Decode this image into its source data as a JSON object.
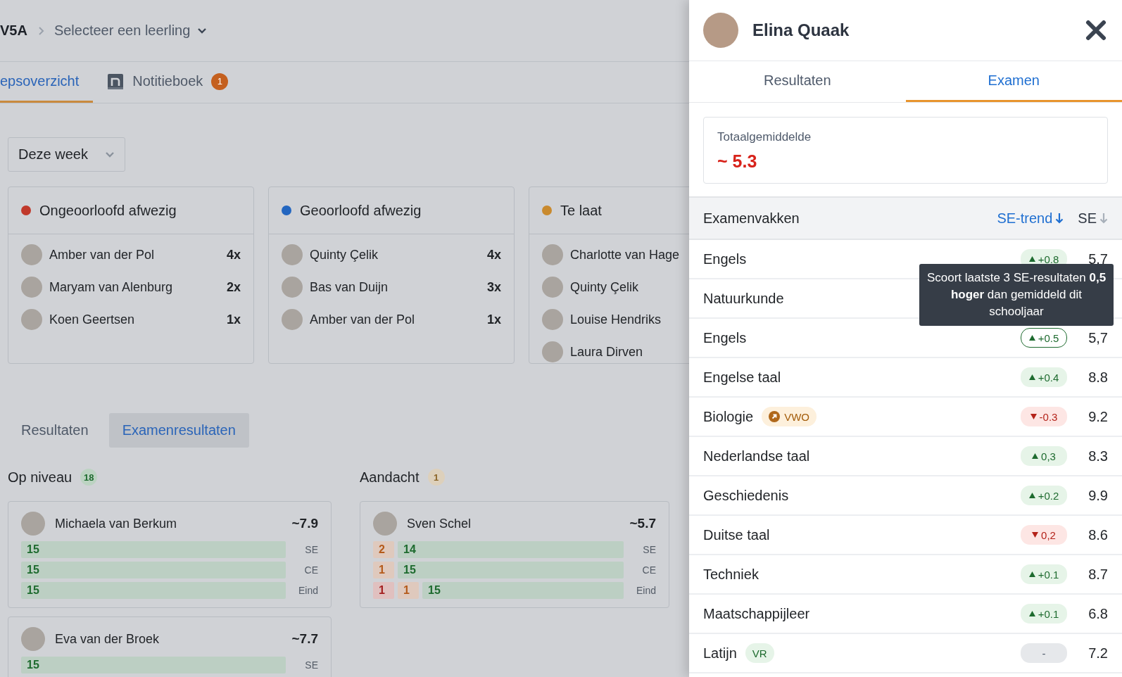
{
  "breadcrumb": {
    "class": "V5A",
    "student_select": "Selecteer een leerling"
  },
  "tabs": [
    {
      "label": "epsoverzicht",
      "selected": true,
      "kind": "plain"
    },
    {
      "label": "Notitieboek",
      "selected": false,
      "kind": "notebook",
      "badge": "1"
    }
  ],
  "period_select": "Deze week",
  "attendance": [
    {
      "title": "Ongeoorloofd afwezig",
      "color": "#c0392b",
      "students": [
        {
          "name": "Amber van der Pol",
          "count": "4x"
        },
        {
          "name": "Maryam van Alenburg",
          "count": "2x"
        },
        {
          "name": "Koen Geertsen",
          "count": "1x"
        }
      ]
    },
    {
      "title": "Geoorloofd afwezig",
      "color": "#2366c0",
      "students": [
        {
          "name": "Quinty Çelik",
          "count": "4x"
        },
        {
          "name": "Bas van Duijn",
          "count": "3x"
        },
        {
          "name": "Amber van der Pol",
          "count": "1x"
        }
      ]
    },
    {
      "title": "Te laat",
      "color": "#c98a2e",
      "students": [
        {
          "name": "Charlotte van Hage"
        },
        {
          "name": "Quinty Çelik"
        },
        {
          "name": "Louise Hendriks"
        },
        {
          "name": "Laura Dirven"
        }
      ]
    }
  ],
  "result_tabs": [
    {
      "label": "Resultaten",
      "selected": false
    },
    {
      "label": "Examenresultaten",
      "selected": true
    }
  ],
  "groups": [
    {
      "title": "Op niveau",
      "count": "18",
      "kind": "good",
      "students": [
        {
          "name": "Michaela van Berkum",
          "average": "~7.9",
          "bars": [
            {
              "label": "SE",
              "segments": [
                {
                  "value": "15",
                  "kind": "good"
                }
              ]
            },
            {
              "label": "CE",
              "segments": [
                {
                  "value": "15",
                  "kind": "good"
                }
              ]
            },
            {
              "label": "Eind",
              "segments": [
                {
                  "value": "15",
                  "kind": "good"
                }
              ]
            }
          ]
        },
        {
          "name": "Eva van der Broek",
          "average": "~7.7",
          "bars": [
            {
              "label": "SE",
              "segments": [
                {
                  "value": "15",
                  "kind": "good"
                }
              ]
            }
          ]
        }
      ]
    },
    {
      "title": "Aandacht",
      "count": "1",
      "kind": "attention",
      "students": [
        {
          "name": "Sven Schel",
          "average": "~5.7",
          "bars": [
            {
              "label": "SE",
              "segments": [
                {
                  "value": "2",
                  "kind": "warn"
                },
                {
                  "value": "14",
                  "kind": "good"
                }
              ]
            },
            {
              "label": "CE",
              "segments": [
                {
                  "value": "1",
                  "kind": "warn"
                },
                {
                  "value": "15",
                  "kind": "good"
                }
              ]
            },
            {
              "label": "Eind",
              "segments": [
                {
                  "value": "1",
                  "kind": "bad"
                },
                {
                  "value": "1",
                  "kind": "warn"
                },
                {
                  "value": "15",
                  "kind": "good"
                }
              ]
            }
          ]
        }
      ]
    }
  ],
  "panel": {
    "student_name": "Elina Quaak",
    "tabs": [
      {
        "label": "Resultaten",
        "selected": false
      },
      {
        "label": "Examen",
        "selected": true
      }
    ],
    "summary": {
      "label": "Totaalgemiddelde",
      "value": "~ 5.3"
    },
    "table": {
      "title": "Examenvakken",
      "sort_columns": [
        {
          "label": "SE-trend",
          "selected": true
        },
        {
          "label": "SE",
          "selected": false
        }
      ],
      "rows": [
        {
          "subject": "Engels",
          "trend": {
            "value": "+0.8",
            "kind": "up"
          },
          "hovered": false,
          "se": "5,7"
        },
        {
          "subject": "Natuurkunde",
          "hovered": false
        },
        {
          "subject": "Engels",
          "trend": {
            "value": "+0.5",
            "kind": "up"
          },
          "hovered": true,
          "se": "5,7"
        },
        {
          "subject": "Engelse taal",
          "trend": {
            "value": "+0.4",
            "kind": "up"
          },
          "hovered": false,
          "se": "8.8"
        },
        {
          "subject": "Biologie",
          "tag": {
            "label": "VWO",
            "kind": "level-up"
          },
          "trend": {
            "value": "-0.3",
            "kind": "down"
          },
          "hovered": false,
          "se": "9.2"
        },
        {
          "subject": "Nederlandse taal",
          "trend": {
            "value": "0,3",
            "kind": "up"
          },
          "hovered": false,
          "se": "8.3"
        },
        {
          "subject": "Geschiedenis",
          "trend": {
            "value": "+0.2",
            "kind": "up"
          },
          "hovered": false,
          "se": "9.9"
        },
        {
          "subject": "Duitse taal",
          "trend": {
            "value": "0,2",
            "kind": "down"
          },
          "hovered": false,
          "se": "8.6"
        },
        {
          "subject": "Techniek",
          "trend": {
            "value": "+0.1",
            "kind": "up"
          },
          "hovered": false,
          "se": "8.7"
        },
        {
          "subject": "Maatschappijleer",
          "trend": {
            "value": "+0.1",
            "kind": "up"
          },
          "hovered": false,
          "se": "6.8"
        },
        {
          "subject": "Latijn",
          "tag": {
            "label": "VR",
            "kind": "plain"
          },
          "trend": {
            "value": "-",
            "kind": "none"
          },
          "hovered": false,
          "se": "7.2"
        }
      ],
      "tooltip": "Scoort laatste 3 SE-resultaten **0,5 hoger** dan gemiddeld dit schooljaar"
    }
  }
}
